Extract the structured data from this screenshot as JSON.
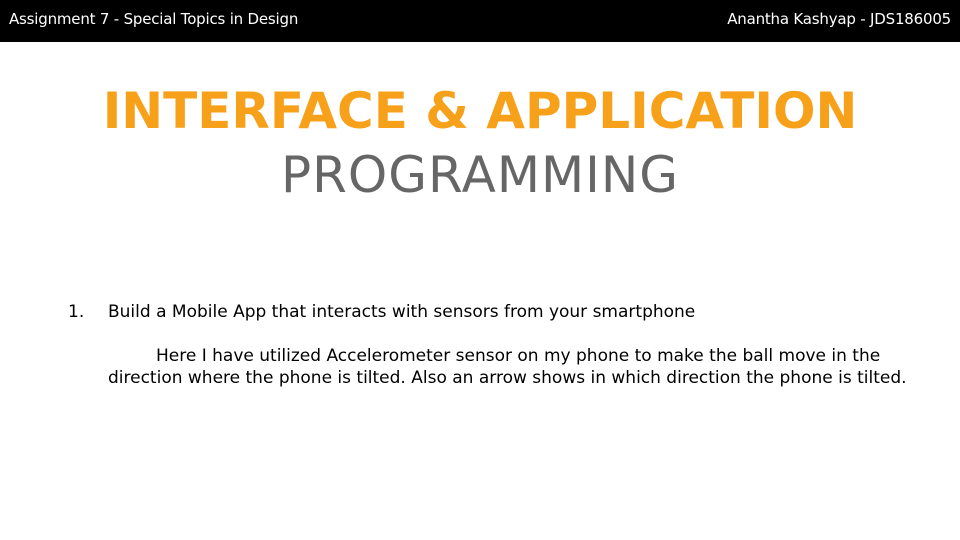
{
  "header": {
    "left_text": "Assignment 7 - Special Topics in Design",
    "right_text": "Anantha Kashyap - JDS186005"
  },
  "title": {
    "line1": "INTERFACE & APPLICATION",
    "line2": "PROGRAMMING"
  },
  "list": {
    "items": [
      {
        "number": "1.",
        "heading": "Build a Mobile App that interacts with sensors from your smartphone",
        "description": "Here I have utilized Accelerometer sensor on my phone to make the ball move in the direction where the phone is tilted. Also an arrow shows in which direction the phone is tilted."
      }
    ]
  },
  "colors": {
    "topbar": "#000000",
    "accent_orange": "#f7a01a",
    "subtitle_gray": "#666666"
  }
}
